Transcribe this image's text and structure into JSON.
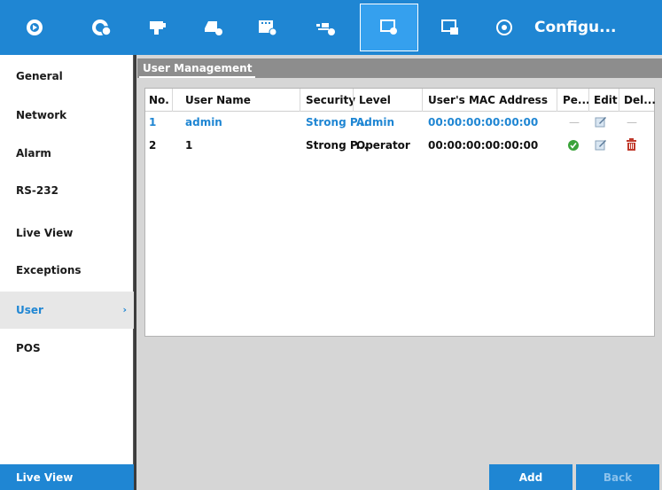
{
  "toolbar": {
    "title": "Configu...",
    "buttons": [
      {
        "icon": "live-view-icon"
      },
      {
        "icon": "playback-icon"
      },
      {
        "icon": "ptz-camera-icon"
      },
      {
        "icon": "record-settings-icon"
      },
      {
        "icon": "camera-settings-icon"
      },
      {
        "icon": "network-settings-icon"
      },
      {
        "icon": "system-config-icon",
        "active": true
      },
      {
        "icon": "maintenance-icon"
      },
      {
        "icon": "power-icon"
      }
    ]
  },
  "sidebar": {
    "items": [
      {
        "label": "General"
      },
      {
        "label": "Network"
      },
      {
        "label": "Alarm"
      },
      {
        "label": "RS-232"
      },
      {
        "label": "Live View"
      },
      {
        "label": "Exceptions"
      },
      {
        "label": "User",
        "active": true
      },
      {
        "label": "POS"
      }
    ],
    "chevron": "›",
    "live_view_button": "Live View"
  },
  "content": {
    "tab": "User Management"
  },
  "table": {
    "headers": {
      "no": "No.",
      "user_name": "User Name",
      "security": "Security",
      "level": "Level",
      "mac": "User's MAC Address",
      "permission": "Pe...",
      "edit": "Edit",
      "delete": "Del..."
    },
    "rows": [
      {
        "no": "1",
        "user_name": "admin",
        "security": "Strong P...",
        "level": "Admin",
        "mac": "00:00:00:00:00:00",
        "permission": "—",
        "delete": "—"
      },
      {
        "no": "2",
        "user_name": "1",
        "security": "Strong P...",
        "level": "Operator",
        "mac": "00:00:00:00:00:00"
      }
    ]
  },
  "buttons": {
    "add": "Add",
    "back": "Back"
  },
  "colors": {
    "accent": "#1f86d3",
    "ok_green": "#3aa33a",
    "delete_red": "#c0392b"
  }
}
